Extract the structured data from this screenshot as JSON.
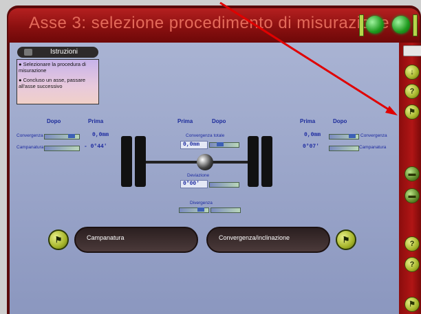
{
  "header": {
    "title": "Asse 3: selezione procedimento di misurazione"
  },
  "instructions": {
    "label": "Istruzioni",
    "lines": [
      "Selezionare la procedura di misurazione",
      "Concluso un asse, passare all'asse successivo"
    ]
  },
  "left": {
    "col_after": "Dopo",
    "col_before": "Prima",
    "toe_label": "Convergenza",
    "camber_label": "Campanatura",
    "toe_value": "0,0mm",
    "camber_value": "- 0°44'"
  },
  "center": {
    "col_before": "Prima",
    "col_after": "Dopo",
    "total_toe_label": "Convergenza totale",
    "total_toe_value": "0,0mm",
    "thrust_label": "Deviazione",
    "thrust_value": "0°00'",
    "offset_label": "Divergenza"
  },
  "right": {
    "col_before": "Prima",
    "col_after": "Dopo",
    "toe_label": "Convergenza",
    "camber_label": "Campanatura",
    "toe_value": "0,0mm",
    "camber_value": "0°07'"
  },
  "buttons": {
    "camber": "Campanatura",
    "toe_camber": "Convergenza/inclinazione"
  },
  "icons": {
    "run": "checkered-flag-icon",
    "side": [
      "arrow-down-icon",
      "question-icon",
      "checkered-flag-icon",
      "car-icon",
      "car-icon",
      "question-icon",
      "question-icon",
      "checkered-flag-icon"
    ]
  },
  "colors": {
    "header": "#8a1010",
    "title": "#e46a5a",
    "panel": "#a9b3d3",
    "accent_button": "#a6b52a",
    "annotation": "#e00000"
  }
}
